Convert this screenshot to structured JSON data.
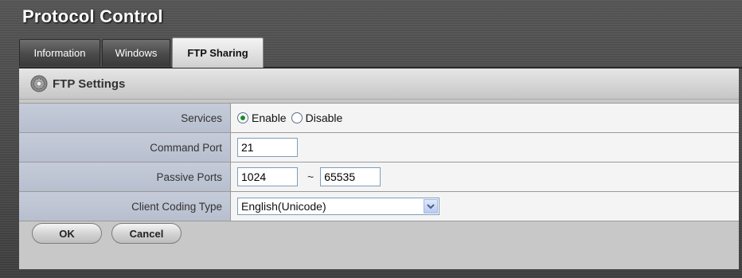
{
  "window": {
    "title": "Protocol Control"
  },
  "tabs": [
    {
      "label": "Information",
      "active": false
    },
    {
      "label": "Windows",
      "active": false
    },
    {
      "label": "FTP Sharing",
      "active": true
    }
  ],
  "section": {
    "title": "FTP Settings",
    "icon": "gear-icon"
  },
  "form": {
    "services": {
      "label": "Services",
      "options": [
        "Enable",
        "Disable"
      ],
      "selected": "Enable"
    },
    "command_port": {
      "label": "Command Port",
      "value": "21"
    },
    "passive_ports": {
      "label": "Passive Ports",
      "from": "1024",
      "separator": "~",
      "to": "65535"
    },
    "client_coding": {
      "label": "Client Coding Type",
      "selected": "English(Unicode)"
    }
  },
  "buttons": {
    "ok": "OK",
    "cancel": "Cancel"
  },
  "colors": {
    "label_bg": "#bec5d4",
    "value_bg": "#f4f4f4",
    "radio_selected": "#1c8c2a"
  }
}
